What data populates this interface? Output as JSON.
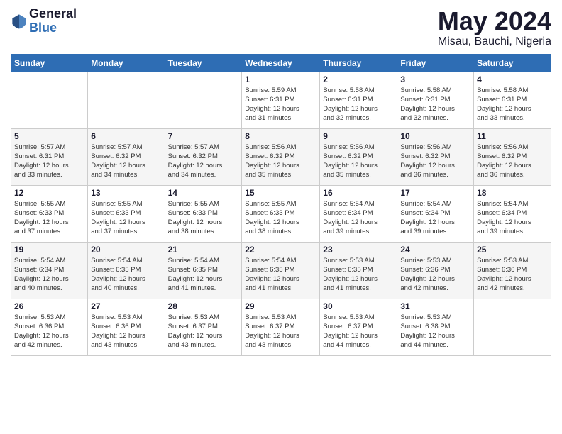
{
  "header": {
    "logo_general": "General",
    "logo_blue": "Blue",
    "month_title": "May 2024",
    "location": "Misau, Bauchi, Nigeria"
  },
  "calendar": {
    "days_of_week": [
      "Sunday",
      "Monday",
      "Tuesday",
      "Wednesday",
      "Thursday",
      "Friday",
      "Saturday"
    ],
    "weeks": [
      [
        {
          "day": "",
          "info": ""
        },
        {
          "day": "",
          "info": ""
        },
        {
          "day": "",
          "info": ""
        },
        {
          "day": "1",
          "info": "Sunrise: 5:59 AM\nSunset: 6:31 PM\nDaylight: 12 hours\nand 31 minutes."
        },
        {
          "day": "2",
          "info": "Sunrise: 5:58 AM\nSunset: 6:31 PM\nDaylight: 12 hours\nand 32 minutes."
        },
        {
          "day": "3",
          "info": "Sunrise: 5:58 AM\nSunset: 6:31 PM\nDaylight: 12 hours\nand 32 minutes."
        },
        {
          "day": "4",
          "info": "Sunrise: 5:58 AM\nSunset: 6:31 PM\nDaylight: 12 hours\nand 33 minutes."
        }
      ],
      [
        {
          "day": "5",
          "info": "Sunrise: 5:57 AM\nSunset: 6:31 PM\nDaylight: 12 hours\nand 33 minutes."
        },
        {
          "day": "6",
          "info": "Sunrise: 5:57 AM\nSunset: 6:32 PM\nDaylight: 12 hours\nand 34 minutes."
        },
        {
          "day": "7",
          "info": "Sunrise: 5:57 AM\nSunset: 6:32 PM\nDaylight: 12 hours\nand 34 minutes."
        },
        {
          "day": "8",
          "info": "Sunrise: 5:56 AM\nSunset: 6:32 PM\nDaylight: 12 hours\nand 35 minutes."
        },
        {
          "day": "9",
          "info": "Sunrise: 5:56 AM\nSunset: 6:32 PM\nDaylight: 12 hours\nand 35 minutes."
        },
        {
          "day": "10",
          "info": "Sunrise: 5:56 AM\nSunset: 6:32 PM\nDaylight: 12 hours\nand 36 minutes."
        },
        {
          "day": "11",
          "info": "Sunrise: 5:56 AM\nSunset: 6:32 PM\nDaylight: 12 hours\nand 36 minutes."
        }
      ],
      [
        {
          "day": "12",
          "info": "Sunrise: 5:55 AM\nSunset: 6:33 PM\nDaylight: 12 hours\nand 37 minutes."
        },
        {
          "day": "13",
          "info": "Sunrise: 5:55 AM\nSunset: 6:33 PM\nDaylight: 12 hours\nand 37 minutes."
        },
        {
          "day": "14",
          "info": "Sunrise: 5:55 AM\nSunset: 6:33 PM\nDaylight: 12 hours\nand 38 minutes."
        },
        {
          "day": "15",
          "info": "Sunrise: 5:55 AM\nSunset: 6:33 PM\nDaylight: 12 hours\nand 38 minutes."
        },
        {
          "day": "16",
          "info": "Sunrise: 5:54 AM\nSunset: 6:34 PM\nDaylight: 12 hours\nand 39 minutes."
        },
        {
          "day": "17",
          "info": "Sunrise: 5:54 AM\nSunset: 6:34 PM\nDaylight: 12 hours\nand 39 minutes."
        },
        {
          "day": "18",
          "info": "Sunrise: 5:54 AM\nSunset: 6:34 PM\nDaylight: 12 hours\nand 39 minutes."
        }
      ],
      [
        {
          "day": "19",
          "info": "Sunrise: 5:54 AM\nSunset: 6:34 PM\nDaylight: 12 hours\nand 40 minutes."
        },
        {
          "day": "20",
          "info": "Sunrise: 5:54 AM\nSunset: 6:35 PM\nDaylight: 12 hours\nand 40 minutes."
        },
        {
          "day": "21",
          "info": "Sunrise: 5:54 AM\nSunset: 6:35 PM\nDaylight: 12 hours\nand 41 minutes."
        },
        {
          "day": "22",
          "info": "Sunrise: 5:54 AM\nSunset: 6:35 PM\nDaylight: 12 hours\nand 41 minutes."
        },
        {
          "day": "23",
          "info": "Sunrise: 5:53 AM\nSunset: 6:35 PM\nDaylight: 12 hours\nand 41 minutes."
        },
        {
          "day": "24",
          "info": "Sunrise: 5:53 AM\nSunset: 6:36 PM\nDaylight: 12 hours\nand 42 minutes."
        },
        {
          "day": "25",
          "info": "Sunrise: 5:53 AM\nSunset: 6:36 PM\nDaylight: 12 hours\nand 42 minutes."
        }
      ],
      [
        {
          "day": "26",
          "info": "Sunrise: 5:53 AM\nSunset: 6:36 PM\nDaylight: 12 hours\nand 42 minutes."
        },
        {
          "day": "27",
          "info": "Sunrise: 5:53 AM\nSunset: 6:36 PM\nDaylight: 12 hours\nand 43 minutes."
        },
        {
          "day": "28",
          "info": "Sunrise: 5:53 AM\nSunset: 6:37 PM\nDaylight: 12 hours\nand 43 minutes."
        },
        {
          "day": "29",
          "info": "Sunrise: 5:53 AM\nSunset: 6:37 PM\nDaylight: 12 hours\nand 43 minutes."
        },
        {
          "day": "30",
          "info": "Sunrise: 5:53 AM\nSunset: 6:37 PM\nDaylight: 12 hours\nand 44 minutes."
        },
        {
          "day": "31",
          "info": "Sunrise: 5:53 AM\nSunset: 6:38 PM\nDaylight: 12 hours\nand 44 minutes."
        },
        {
          "day": "",
          "info": ""
        }
      ]
    ]
  }
}
